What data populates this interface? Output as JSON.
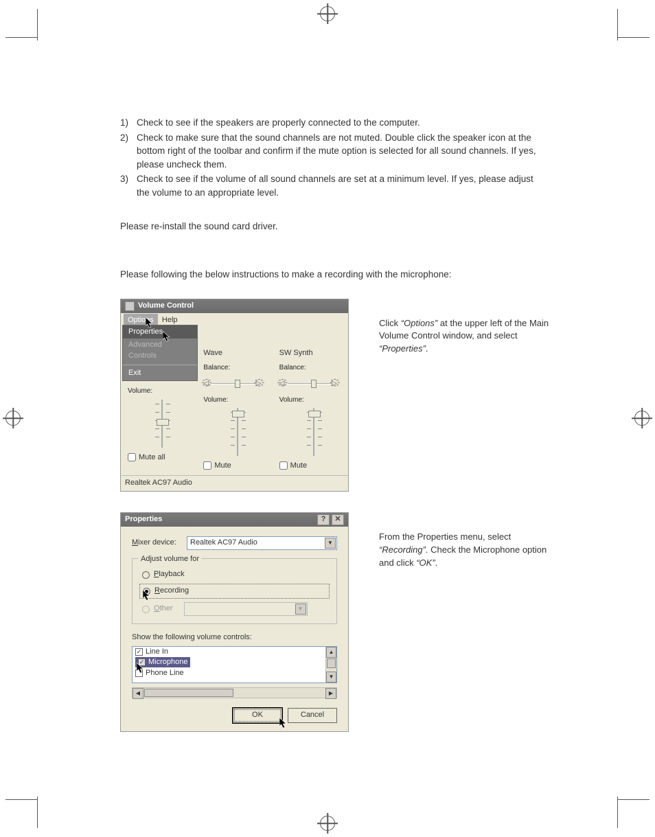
{
  "instructions": {
    "items": [
      {
        "num": "1)",
        "text": "Check to see if the speakers are properly connected to the computer."
      },
      {
        "num": "2)",
        "text": "Check to make sure that the sound channels are not muted. Double click the speaker icon at the bottom right of the toolbar and confirm if the mute option is selected for all sound channels. If yes, please uncheck them."
      },
      {
        "num": "3)",
        "text": "Check to see if the volume of all sound channels are set at a minimum level. If yes, please adjust the volume to an appropriate level."
      }
    ],
    "reinstall": "Please re-install the sound card driver.",
    "intro": "Please following the below instructions to make a recording with the microphone:"
  },
  "volume_control": {
    "title": "Volume Control",
    "menu": {
      "options": "Options",
      "help": "Help"
    },
    "dropdown": {
      "properties": "Properties",
      "advanced": "Advanced Controls",
      "exit": "Exit"
    },
    "panels": [
      {
        "name": "",
        "balance": "Balance:",
        "volume": "Volume:",
        "mute_label": "Mute all"
      },
      {
        "name": "Wave",
        "balance": "Balance:",
        "volume": "Volume:",
        "mute_label": "Mute"
      },
      {
        "name": "SW Synth",
        "balance": "Balance:",
        "volume": "Volume:",
        "mute_label": "Mute"
      }
    ],
    "status": "Realtek AC97 Audio"
  },
  "side_text_1": {
    "a": "Click ",
    "b": "“Options”",
    "c": " at the upper left of the Main Volume Control window, and select ",
    "d": "“Properties”",
    "e": "."
  },
  "properties": {
    "title": "Properties",
    "mixer_label": "Mixer device:",
    "mixer_value": "Realtek AC97 Audio",
    "group_label": "Adjust volume for",
    "radios": {
      "playback": "Playback",
      "recording": "Recording",
      "other": "Other"
    },
    "list_label": "Show the following volume controls:",
    "list_items": [
      "Line In",
      "Microphone",
      "Phone Line"
    ],
    "ok": "OK",
    "cancel": "Cancel"
  },
  "side_text_2": {
    "a": "From the Properties menu, select ",
    "b": "“Recording”",
    "c": ". Check the Microphone option and click ",
    "d": "“OK”",
    "e": "."
  }
}
